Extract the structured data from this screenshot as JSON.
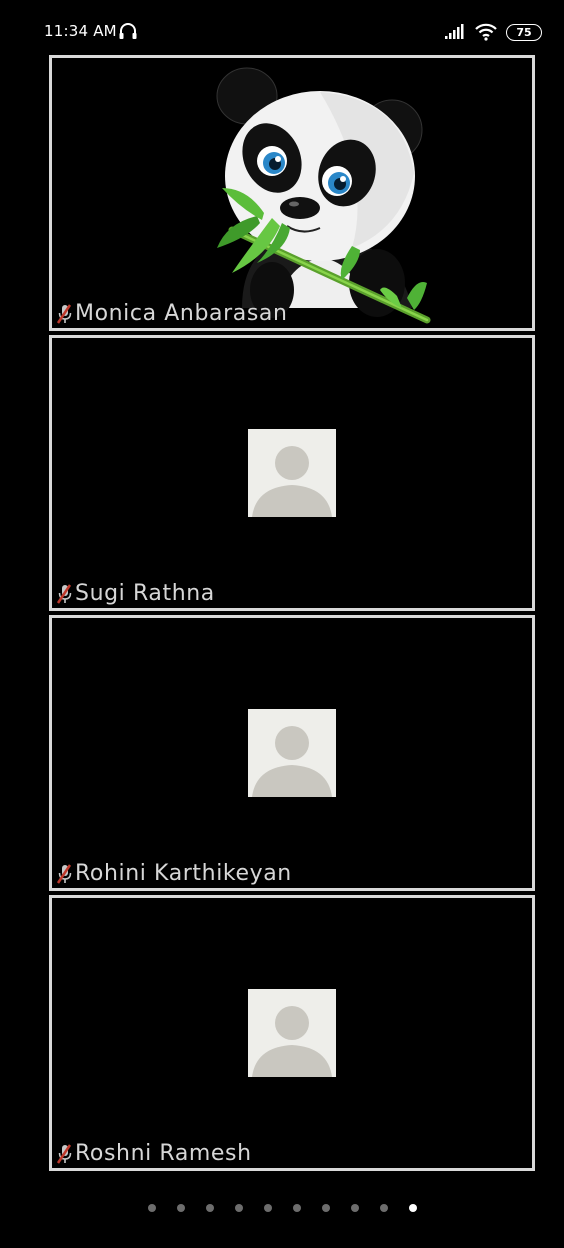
{
  "status_bar": {
    "time": "11:34 AM",
    "battery": "75",
    "icons": [
      "headphone-icon",
      "signal-icon",
      "wifi-icon",
      "battery-icon"
    ]
  },
  "participants": [
    {
      "name": "Monica Anbarasan",
      "video": "panda-image",
      "mic": "mic-muted-icon"
    },
    {
      "name": "Sugi Rathna",
      "video": "default-avatar",
      "mic": "mic-muted-icon"
    },
    {
      "name": "Rohini Karthikeyan",
      "video": "default-avatar",
      "mic": "mic-muted-icon"
    },
    {
      "name": "Roshni Ramesh",
      "video": "default-avatar",
      "mic": "mic-muted-icon"
    }
  ],
  "pagination": {
    "total_pages": 10,
    "current_page": 10
  },
  "colors": {
    "background": "#000000",
    "tile_border": "#d9d9d9",
    "name_text": "#d7d7d7",
    "mic_muted": "#c0392b",
    "dot_inactive": "#6d6d6d",
    "dot_active": "#ffffff"
  }
}
